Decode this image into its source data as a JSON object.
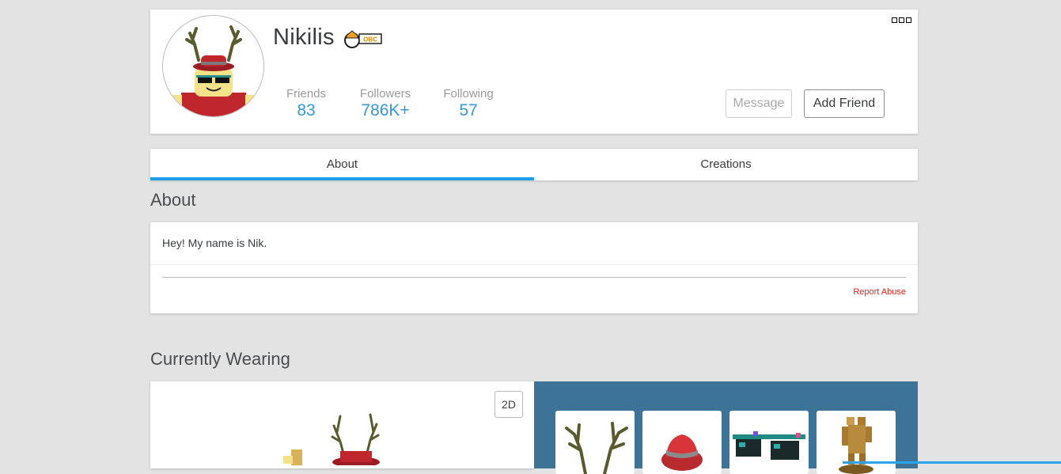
{
  "profile": {
    "username": "Nikilis",
    "badge_text": "OBC",
    "stats": [
      {
        "label": "Friends",
        "value": "83"
      },
      {
        "label": "Followers",
        "value": "786K+"
      },
      {
        "label": "Following",
        "value": "57"
      }
    ],
    "message_label": "Message",
    "add_friend_label": "Add Friend",
    "more_icon": "ellipsis-icon"
  },
  "tabs": [
    {
      "label": "About",
      "active": true
    },
    {
      "label": "Creations",
      "active": false
    }
  ],
  "about": {
    "title": "About",
    "text": "Hey! My name is Nik.",
    "report_label": "Report Abuse"
  },
  "wearing": {
    "title": "Currently Wearing",
    "toggle_label": "2D",
    "items": [
      "antlers",
      "red-fedora",
      "pixel-shades",
      "gold-figure"
    ]
  },
  "colors": {
    "accent": "#1ea0e8",
    "stat_value": "#3598d8",
    "report": "#e2231a",
    "wearing_panel": "#3e7398"
  }
}
